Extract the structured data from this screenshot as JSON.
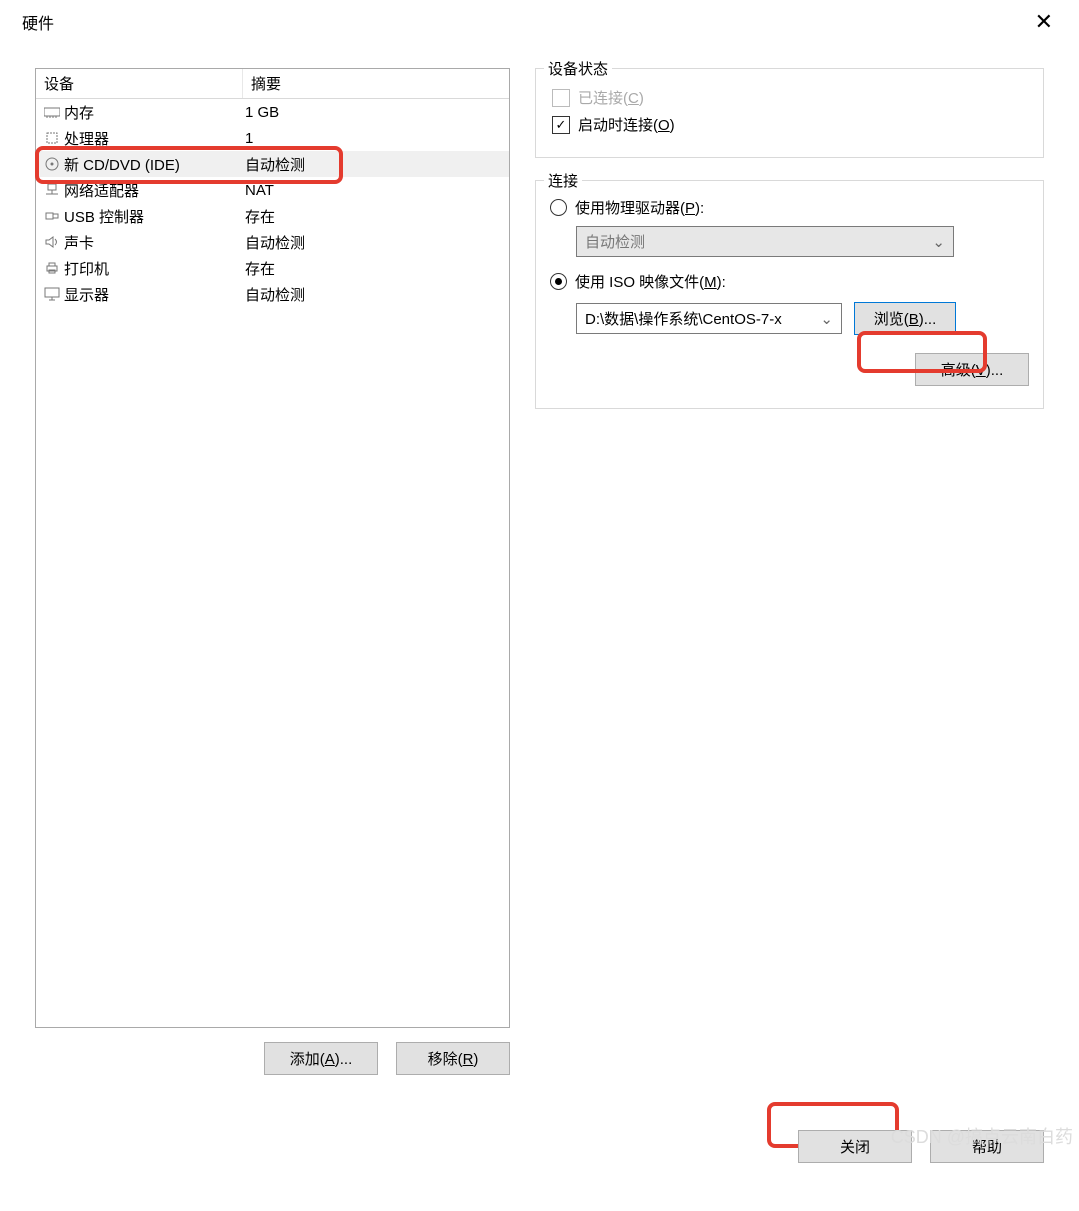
{
  "title": "硬件",
  "headers": {
    "device": "设备",
    "summary": "摘要"
  },
  "devices": [
    {
      "icon": "memory",
      "name": "内存",
      "summary": "1 GB"
    },
    {
      "icon": "cpu",
      "name": "处理器",
      "summary": "1"
    },
    {
      "icon": "disc",
      "name": "新 CD/DVD (IDE)",
      "summary": "自动检测",
      "selected": true
    },
    {
      "icon": "net",
      "name": "网络适配器",
      "summary": "NAT"
    },
    {
      "icon": "usb",
      "name": "USB 控制器",
      "summary": "存在"
    },
    {
      "icon": "sound",
      "name": "声卡",
      "summary": "自动检测"
    },
    {
      "icon": "printer",
      "name": "打印机",
      "summary": "存在"
    },
    {
      "icon": "display",
      "name": "显示器",
      "summary": "自动检测"
    }
  ],
  "leftButtons": {
    "add": "添加(",
    "addKey": "A",
    "addTail": ")...",
    "remove": "移除(",
    "removeKey": "R",
    "removeTail": ")"
  },
  "status": {
    "title": "设备状态",
    "connected": {
      "label": "已连接(",
      "key": "C",
      "tail": ")",
      "checked": false,
      "disabled": true
    },
    "startup": {
      "label": "启动时连接(",
      "key": "O",
      "tail": ")",
      "checked": true,
      "disabled": false
    }
  },
  "connection": {
    "title": "连接",
    "physical": {
      "label": "使用物理驱动器(",
      "key": "P",
      "tail": "):",
      "selected": false
    },
    "physicalCombo": "自动检测",
    "iso": {
      "label": "使用 ISO 映像文件(",
      "key": "M",
      "tail": "):",
      "selected": true
    },
    "isoPath": "D:\\数据\\操作系统\\CentOS-7-x",
    "browse": {
      "label": "浏览(",
      "key": "B",
      "tail": ")..."
    },
    "advanced": {
      "label": "高级(",
      "key": "V",
      "tail": ")..."
    }
  },
  "footer": {
    "close": "关闭",
    "help": "帮助"
  },
  "watermark": "CSDN @搞点云南白药"
}
